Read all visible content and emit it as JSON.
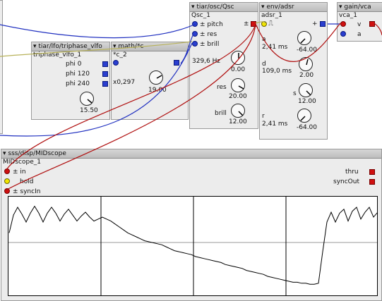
{
  "qsc": {
    "title": "tiar/osc/Qsc",
    "instance": "Qsc_1",
    "inputs": [
      "± pitch",
      "± res",
      "± brill"
    ],
    "out_label": "±",
    "freq": "329,6 Hz",
    "knob_values": [
      "0.00",
      "20.00",
      "12.00"
    ],
    "knob_labels": [
      "res",
      "brill"
    ]
  },
  "adsr": {
    "title": "env/adsr",
    "instance": "adsr_1",
    "params": [
      {
        "label": "a",
        "value": "2,41 ms",
        "knob": "-64.00"
      },
      {
        "label": "d",
        "value": "109,0 ms",
        "knob": "2.00"
      },
      {
        "label": "s",
        "value": "",
        "knob": "12.00"
      },
      {
        "label": "r",
        "value": "2,41 ms",
        "knob": "-64.00"
      }
    ],
    "out_label": "+"
  },
  "vca": {
    "title": "gain/vca",
    "instance": "vca_1",
    "in_v": "v",
    "in_a": "a"
  },
  "lfo": {
    "title": "tiar/lfo/triphase_vlfo",
    "instance": "triphase_vlfo_1",
    "outputs": [
      "phi 0",
      "phi 120",
      "phi 240"
    ],
    "knob_value": "15.50"
  },
  "mathc": {
    "title": "math/*c",
    "instance": "*c_2",
    "value": "x0,297",
    "knob_value": "19.00"
  },
  "scope": {
    "title": "sss/disp/MIDscope",
    "instance": "MIDscope_1",
    "inputs": [
      "± in",
      "hold",
      "± syncIn"
    ],
    "outputs": [
      "thru",
      "syncOut"
    ]
  },
  "colors": {
    "wire_blue": "#2030c0",
    "wire_red": "#b01010",
    "wire_yellow": "#b8b25a"
  },
  "scope_waveform": {
    "y_range": [
      0,
      1
    ],
    "samples": [
      0.36,
      0.18,
      0.1,
      0.17,
      0.25,
      0.16,
      0.09,
      0.16,
      0.25,
      0.16,
      0.1,
      0.16,
      0.24,
      0.17,
      0.12,
      0.18,
      0.24,
      0.19,
      0.15,
      0.2,
      0.24,
      0.22,
      0.2,
      0.22,
      0.24,
      0.27,
      0.3,
      0.33,
      0.36,
      0.38,
      0.4,
      0.42,
      0.44,
      0.45,
      0.46,
      0.47,
      0.48,
      0.5,
      0.52,
      0.54,
      0.55,
      0.56,
      0.57,
      0.58,
      0.6,
      0.61,
      0.62,
      0.63,
      0.64,
      0.65,
      0.66,
      0.68,
      0.69,
      0.7,
      0.71,
      0.72,
      0.74,
      0.75,
      0.76,
      0.77,
      0.78,
      0.8,
      0.81,
      0.82,
      0.83,
      0.84,
      0.85,
      0.86,
      0.86,
      0.87,
      0.87,
      0.88,
      0.88,
      0.87,
      0.55,
      0.25,
      0.15,
      0.25,
      0.16,
      0.12,
      0.24,
      0.14,
      0.1,
      0.22,
      0.15,
      0.1,
      0.2,
      0.15
    ]
  }
}
